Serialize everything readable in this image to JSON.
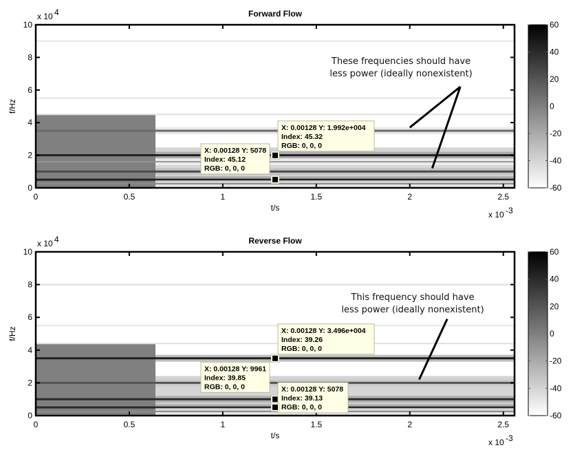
{
  "chart_data": [
    {
      "type": "heatmap",
      "subtype": "spectrogram",
      "title": "Forward Flow",
      "xlabel": "t/s",
      "ylabel": "f/Hz",
      "x_exponent_label": "x 10",
      "x_exponent": "-3",
      "y_exponent_label": "x 10",
      "y_exponent": "4",
      "xlim": [
        0,
        2.56
      ],
      "ylim": [
        0,
        10
      ],
      "xticks": [
        0,
        0.5,
        1,
        1.5,
        2,
        2.5
      ],
      "xtick_labels": [
        "0",
        "0.5",
        "1",
        "1.5",
        "2",
        "2.5"
      ],
      "yticks": [
        0,
        2,
        4,
        6,
        8,
        10
      ],
      "ytick_labels": [
        "0",
        "2",
        "4",
        "6",
        "8",
        "10"
      ],
      "colorbar": {
        "ticks": [
          -60,
          -40,
          -20,
          0,
          20,
          40,
          60
        ],
        "tick_labels": [
          "-60",
          "-40",
          "-20",
          "0",
          "20",
          "40",
          "60"
        ],
        "clim": [
          -60,
          60
        ],
        "colormap": "gray-reversed"
      },
      "segment_boundary_x": 0.64,
      "background_level": -60,
      "left_region": {
        "x": [
          0,
          0.64
        ],
        "ymax": 4.5,
        "level": 0
      },
      "bands": [
        {
          "y": 9.0,
          "level": -48
        },
        {
          "y": 5.5,
          "level": -48
        },
        {
          "y": 4.5,
          "level": -45
        },
        {
          "y": 3.5,
          "level": 10
        },
        {
          "y": 2.0,
          "level": 45
        },
        {
          "y": 1.6,
          "level": -10
        },
        {
          "y": 1.0,
          "level": 25
        },
        {
          "y": 0.5,
          "level": 45
        },
        {
          "y": 0.25,
          "level": -5
        }
      ],
      "datatips": [
        {
          "x": "0.00128",
          "y": "1.992e+004",
          "index": "45.32",
          "rgb": "0, 0, 0",
          "px": 1.28,
          "py": 1.992
        },
        {
          "x": "0.00128",
          "y": "5078",
          "index": "45.12",
          "rgb": "0, 0, 0",
          "px": 1.28,
          "py": 0.5078
        }
      ],
      "annotation": {
        "lines": [
          "These frequencies should have",
          "less power (ideally nonexistent)"
        ],
        "arrow_targets": [
          [
            2.0,
            3.7
          ],
          [
            2.12,
            1.2
          ]
        ],
        "arrow_origin": [
          2.27,
          6.2
        ]
      }
    },
    {
      "type": "heatmap",
      "subtype": "spectrogram",
      "title": "Reverse Flow",
      "xlabel": "t/s",
      "ylabel": "f/Hz",
      "x_exponent_label": "x 10",
      "x_exponent": "-3",
      "y_exponent_label": "x 10",
      "y_exponent": "4",
      "xlim": [
        0,
        2.56
      ],
      "ylim": [
        0,
        10
      ],
      "xticks": [
        0,
        0.5,
        1,
        1.5,
        2,
        2.5
      ],
      "xtick_labels": [
        "0",
        "0.5",
        "1",
        "1.5",
        "2",
        "2.5"
      ],
      "yticks": [
        0,
        2,
        4,
        6,
        8,
        10
      ],
      "ytick_labels": [
        "0",
        "2",
        "4",
        "6",
        "8",
        "10"
      ],
      "colorbar": {
        "ticks": [
          -60,
          -40,
          -20,
          0,
          20,
          40,
          60
        ],
        "tick_labels": [
          "-60",
          "-40",
          "-20",
          "0",
          "20",
          "40",
          "60"
        ],
        "clim": [
          -60,
          60
        ],
        "colormap": "gray-reversed"
      },
      "segment_boundary_x": 0.64,
      "background_level": -60,
      "left_region": {
        "x": [
          0,
          0.64
        ],
        "ymax": 4.4,
        "level": 0
      },
      "bands": [
        {
          "y": 8.0,
          "level": -45
        },
        {
          "y": 5.5,
          "level": -48
        },
        {
          "y": 4.4,
          "level": -45
        },
        {
          "y": 3.5,
          "level": 45
        },
        {
          "y": 2.0,
          "level": 20
        },
        {
          "y": 1.0,
          "level": 40
        },
        {
          "y": 0.5,
          "level": 40
        },
        {
          "y": 0.25,
          "level": -5
        }
      ],
      "datatips": [
        {
          "x": "0.00128",
          "y": "3.496e+004",
          "index": "39.26",
          "rgb": "0, 0, 0",
          "px": 1.28,
          "py": 3.496
        },
        {
          "x": "0.00128",
          "y": "9961",
          "index": "39.85",
          "rgb": "0, 0, 0",
          "px": 1.28,
          "py": 0.9961
        },
        {
          "x": "0.00128",
          "y": "5078",
          "index": "39.13",
          "rgb": "0, 0, 0",
          "px": 1.28,
          "py": 0.5078
        }
      ],
      "annotation": {
        "lines": [
          "This frequency should have",
          "less power (ideally nonexistent)"
        ],
        "arrow_targets": [
          [
            2.05,
            2.2
          ]
        ],
        "arrow_origin": [
          2.2,
          5.9
        ]
      }
    }
  ],
  "datatip_labels": {
    "x_prefix": "X: ",
    "y_prefix": " Y: ",
    "index_prefix": "Index: ",
    "rgb_prefix": "RGB: "
  }
}
